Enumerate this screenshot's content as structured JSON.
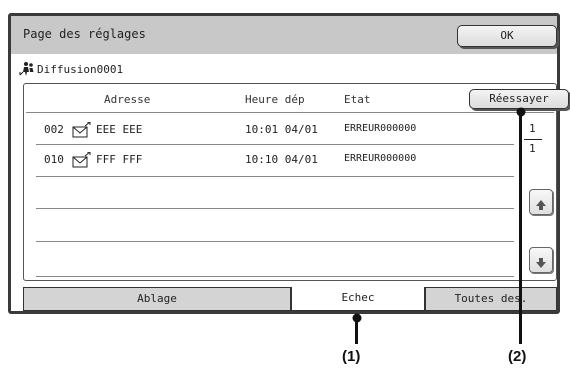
{
  "header": {
    "title": "Page des réglages",
    "ok_label": "OK"
  },
  "destination": {
    "name": "Diffusion0001"
  },
  "table": {
    "columns": [
      "Adresse",
      "Heure dép",
      "Etat"
    ],
    "retry_label": "Réessayer",
    "rows": [
      {
        "num": "002",
        "address": "EEE EEE",
        "time": "10:01 04/01",
        "status": "ERREUR000000"
      },
      {
        "num": "010",
        "address": "FFF FFF",
        "time": "10:10 04/01",
        "status": "ERREUR000000"
      }
    ]
  },
  "pagination": {
    "current": "1",
    "total": "1"
  },
  "tabs": [
    {
      "label": "Ablage",
      "active": false
    },
    {
      "label": "Echec",
      "active": true
    },
    {
      "label": "Toutes des.",
      "active": false
    }
  ],
  "callouts": [
    {
      "label": "(1)"
    },
    {
      "label": "(2)"
    }
  ]
}
